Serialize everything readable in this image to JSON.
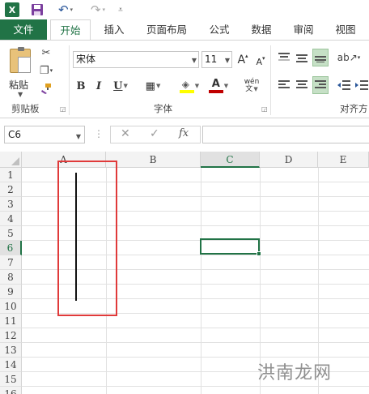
{
  "quick_access": {
    "app_logo": "X",
    "icons": [
      "excel-logo-icon",
      "save-icon",
      "undo-icon",
      "redo-icon",
      "customize-qat-icon"
    ]
  },
  "tabs": [
    {
      "label": "文件"
    },
    {
      "label": "开始"
    },
    {
      "label": "插入"
    },
    {
      "label": "页面布局"
    },
    {
      "label": "公式"
    },
    {
      "label": "数据"
    },
    {
      "label": "审阅"
    },
    {
      "label": "视图"
    }
  ],
  "ribbon": {
    "clipboard": {
      "paste_label": "粘贴",
      "group_label": "剪贴板"
    },
    "font": {
      "font_name": "宋体",
      "font_size": "11",
      "bold": "B",
      "italic": "I",
      "underline": "U",
      "grow": "A",
      "shrink": "A",
      "font_color_letter": "A",
      "phonetic": "wén",
      "group_label": "字体"
    },
    "alignment": {
      "group_label": "对齐方"
    }
  },
  "formula_bar": {
    "name_box": "C6",
    "cancel": "✕",
    "enter": "✓",
    "fx": "fx",
    "formula_value": ""
  },
  "grid": {
    "columns": [
      "A",
      "B",
      "C",
      "D",
      "E"
    ],
    "rows": [
      "1",
      "2",
      "3",
      "4",
      "5",
      "6",
      "7",
      "8",
      "9",
      "10",
      "11",
      "12",
      "13",
      "14",
      "15",
      "16"
    ],
    "selected_column": "C",
    "selected_row": "6"
  },
  "watermark": "洪南龙网",
  "colors": {
    "excel_green": "#217346",
    "annotation_red": "#e03a3a",
    "font_color_bar": "#c00000",
    "highlight_bar": "#ffff00"
  }
}
